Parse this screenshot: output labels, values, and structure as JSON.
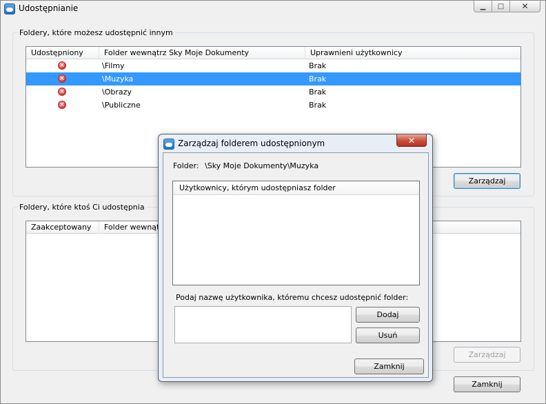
{
  "window": {
    "title": "Udostępnianie",
    "controls": {
      "minimize": "▁",
      "maximize": "□",
      "close": "✕"
    }
  },
  "shared_by_me": {
    "group_label": "Foldery, które możesz udostępnić innym",
    "columns": [
      "Udostępniony",
      "Folder wewnątrz Sky Moje Dokumenty",
      "Uprawnieni użytkownicy"
    ],
    "rows": [
      {
        "status_icon": "remove-icon",
        "folder": "\\Filmy",
        "users": "Brak",
        "selected": false
      },
      {
        "status_icon": "remove-icon",
        "folder": "\\Muzyka",
        "users": "Brak",
        "selected": true
      },
      {
        "status_icon": "remove-icon",
        "folder": "\\Obrazy",
        "users": "Brak",
        "selected": false
      },
      {
        "status_icon": "remove-icon",
        "folder": "\\Publiczne",
        "users": "Brak",
        "selected": false
      }
    ],
    "manage_label": "Zarządzaj"
  },
  "shared_with_me": {
    "group_label": "Foldery, które ktoś Ci udostępnia",
    "columns": [
      "Zaakceptowany",
      "Folder wewnątrz"
    ],
    "rows": [],
    "manage_label": "Zarządzaj",
    "manage_enabled": false
  },
  "main_close_label": "Zamknij",
  "dialog": {
    "title": "Zarządzaj folderem udostępnionym",
    "close_glyph": "✕",
    "folder_label": "Folder:",
    "folder_value": "\\Sky Moje Dokumenty\\Muzyka",
    "users_header": "Użytkownicy, którym udostępniasz folder",
    "users": [],
    "prompt": "Podaj nazwę użytkownika, któremu chcesz udostępnić folder:",
    "username_value": "",
    "add_label": "Dodaj",
    "remove_label": "Usuń",
    "close_label": "Zamknij"
  },
  "colors": {
    "selection": "#3399ff",
    "status_error": "#d73a3a",
    "dialog_close": "#c7503d"
  }
}
